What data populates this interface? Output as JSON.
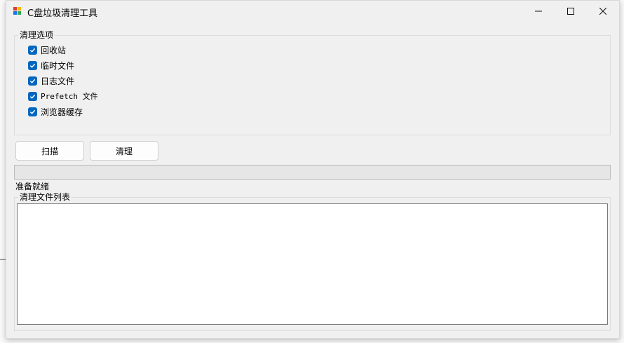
{
  "window": {
    "title": "C盘垃圾清理工具",
    "minimize_glyph": "—",
    "maximize_glyph": "☐",
    "close_glyph": "✕"
  },
  "options_group": {
    "legend": "清理选项",
    "items": [
      {
        "label": "回收站",
        "checked": true
      },
      {
        "label": "临时文件",
        "checked": true
      },
      {
        "label": "日志文件",
        "checked": true
      },
      {
        "label": "Prefetch 文件",
        "checked": true
      },
      {
        "label": "浏览器缓存",
        "checked": true
      }
    ]
  },
  "buttons": {
    "scan_label": "扫描",
    "clean_label": "清理"
  },
  "progress": {
    "value": 0
  },
  "status_text": "准备就绪",
  "file_list_group": {
    "legend": "清理文件列表"
  },
  "accent_color": "#0067c0"
}
